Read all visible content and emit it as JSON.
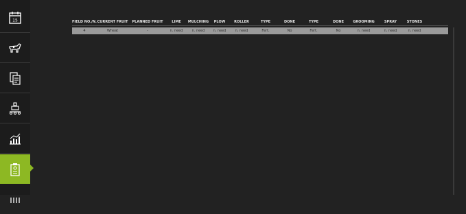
{
  "table": {
    "columns": [
      "FIELD NO./N...",
      "CURRENT FRUIT",
      "PLANNED FRUIT",
      "LIME",
      "MULCHING",
      "PLOW",
      "ROLLER",
      "TYPE",
      "DONE",
      "TYPE",
      "DONE",
      "GROOMING",
      "SPRAY",
      "STONES"
    ],
    "rows": [
      [
        "4",
        "Wheat",
        "-",
        "n. need",
        "n. need",
        "n. need",
        "n. need",
        "Fert.",
        "No",
        "Fert.",
        "No",
        "n. need",
        "n. need",
        "n. need"
      ]
    ]
  },
  "sidebar": {
    "items": [
      {
        "icon": "calendar-icon"
      },
      {
        "icon": "livestock-icon"
      },
      {
        "icon": "contracts-icon"
      },
      {
        "icon": "production-icon"
      },
      {
        "icon": "statistics-icon"
      },
      {
        "icon": "field-plan-icon",
        "active": true
      },
      {
        "icon": "more-icon"
      }
    ]
  },
  "colors": {
    "accent": "#8db823",
    "background": "#222222",
    "row": "#9a9a9a"
  }
}
